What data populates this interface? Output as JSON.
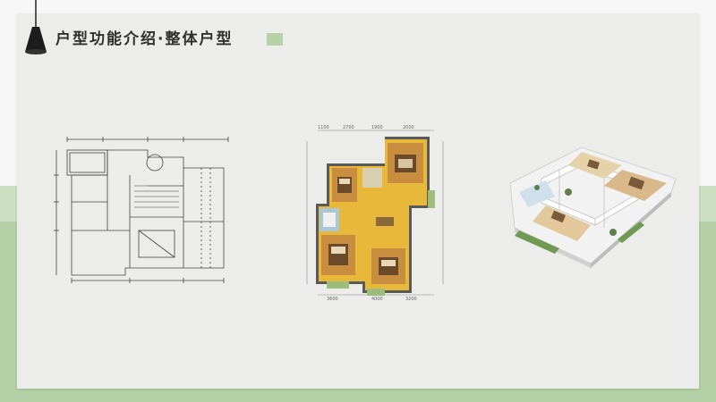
{
  "header": {
    "title": "户型功能介绍·整体户型"
  },
  "colors": {
    "accent_green": "#b6d3a7",
    "band_green": "#c9dfc0",
    "card_background": "#ececea",
    "title_text": "#2f2f2f"
  },
  "icons": {
    "lamp": "pendant-lamp-icon"
  },
  "plans": {
    "colored_plan": {
      "dimensions_top": [
        "1100",
        "2700",
        "1900",
        "2000"
      ],
      "dimensions_bottom": [
        "3600",
        "4000",
        "3200"
      ]
    }
  }
}
